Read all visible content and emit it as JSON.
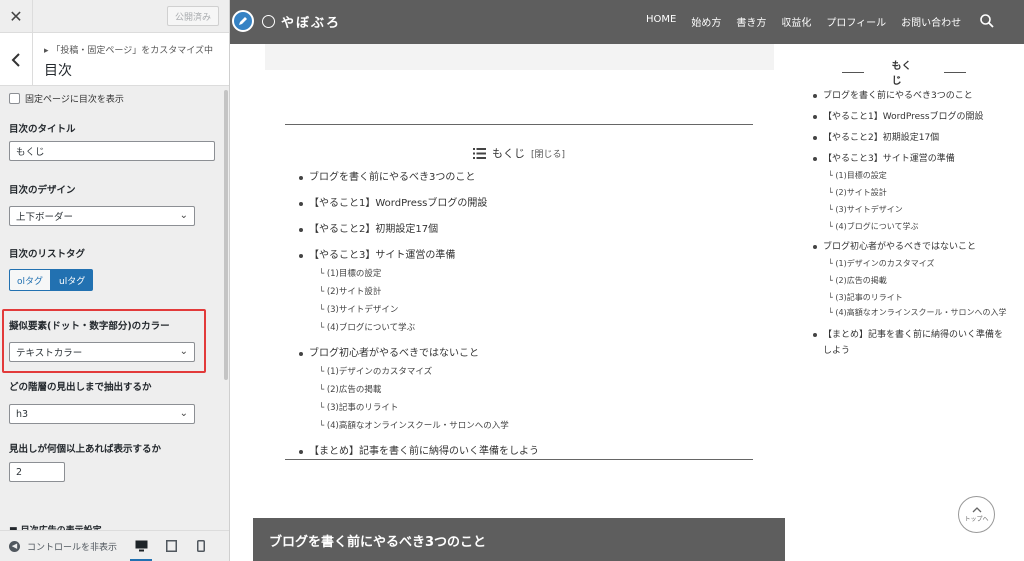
{
  "sidebar": {
    "close_icon": "close-icon",
    "publish_label": "公開済み",
    "breadcrumb": "「投稿・固定ページ」をカスタマイズ中",
    "title": "目次",
    "checkbox_label": "固定ページに目次を表示",
    "fields": {
      "toc_title_label": "目次のタイトル",
      "toc_title_value": "もくじ",
      "design_label": "目次のデザイン",
      "design_value": "上下ボーダー",
      "list_tag_label": "目次のリストタグ",
      "list_tag_options": [
        "olタグ",
        "ulタグ"
      ],
      "list_tag_selected": "ulタグ",
      "pseudo_color_label": "擬似要素(ドット・数字部分)のカラー",
      "pseudo_color_value": "テキストカラー",
      "heading_level_label": "どの階層の見出しまで抽出するか",
      "heading_level_value": "h3",
      "min_count_label": "見出しが何個以上あれば表示するか",
      "min_count_value": "2",
      "cut_section_label": "■ 目次広告の表示設定"
    },
    "footer": {
      "hide_controls_label": "コントロールを非表示",
      "devices": [
        "desktop-icon",
        "tablet-icon",
        "mobile-icon"
      ]
    }
  },
  "header": {
    "logo_text": "やぼぶろ",
    "nav": [
      "HOME",
      "始め方",
      "書き方",
      "収益化",
      "プロフィール",
      "お問い合わせ"
    ]
  },
  "toc": {
    "title": "もくじ",
    "close_label": "[閉じる]",
    "items": [
      {
        "label": "ブログを書く前にやるべき3つのこと",
        "subs": []
      },
      {
        "label": "【やること1】WordPressブログの開設",
        "subs": []
      },
      {
        "label": "【やること2】初期設定17個",
        "subs": []
      },
      {
        "label": "【やること3】サイト運営の準備",
        "subs": [
          "└ (1)目標の設定",
          "└ (2)サイト設計",
          "└ (3)サイトデザイン",
          "└ (4)ブログについて学ぶ"
        ]
      },
      {
        "label": "ブログ初心者がやるべきではないこと",
        "subs": [
          "└ (1)デザインのカスタマイズ",
          "└ (2)広告の掲載",
          "└ (3)記事のリライト",
          "└ (4)高額なオンラインスクール・サロンへの入学"
        ]
      },
      {
        "label": "【まとめ】記事を書く前に納得のいく準備をしよう",
        "subs": []
      }
    ]
  },
  "post_heading": "ブログを書く前にやるべき3つのこと",
  "widget": {
    "title": "もくじ",
    "items": [
      {
        "label": "ブログを書く前にやるべき3つのこと",
        "subs": []
      },
      {
        "label": "【やること1】WordPressブログの開設",
        "subs": []
      },
      {
        "label": "【やること2】初期設定17個",
        "subs": []
      },
      {
        "label": "【やること3】サイト運営の準備",
        "subs": [
          "└ (1)目標の設定",
          "└ (2)サイト設計",
          "└ (3)サイトデザイン",
          "└ (4)ブログについて学ぶ"
        ]
      },
      {
        "label": "ブログ初心者がやるべきではないこと",
        "subs": [
          "└ (1)デザインのカスタマイズ",
          "└ (2)広告の掲載",
          "└ (3)記事のリライト",
          "└ (4)高額なオンラインスクール・サロンへの入学"
        ]
      },
      {
        "label": "【まとめ】記事を書く前に納得のいく準備をしよう",
        "subs": []
      }
    ]
  },
  "to_top_label": "トップへ",
  "colors": {
    "header_bg": "#5e5e5e",
    "accent_blue": "#2271b1",
    "highlight_red": "#e23a3a"
  }
}
